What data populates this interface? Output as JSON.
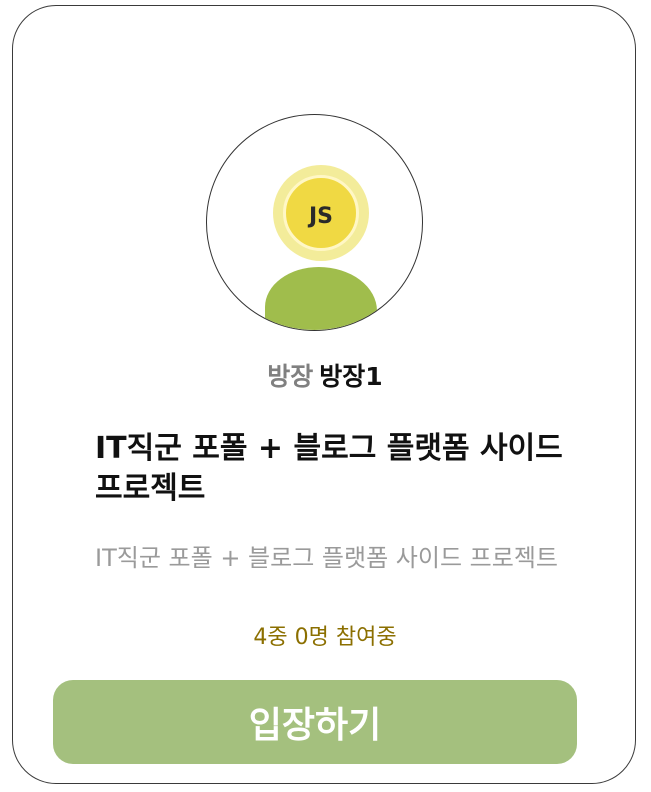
{
  "room": {
    "avatar_badge": "JS",
    "avatar_icon": "user-avatar-icon",
    "owner_role_label": "방장",
    "owner_name": "방장1",
    "title": "IT직군 포폴 + 블로그 플랫폼 사이드 프로젝트",
    "description": "IT직군 포폴 + 블로그 플랫폼 사이드 프로젝트",
    "participants": "4중 0명 참여중",
    "enter_button_label": "입장하기"
  },
  "colors": {
    "accent_green": "#a4c07e",
    "count_text": "#8b6f00",
    "avatar_head": "#f0d943",
    "avatar_body": "#a0bd4c"
  }
}
